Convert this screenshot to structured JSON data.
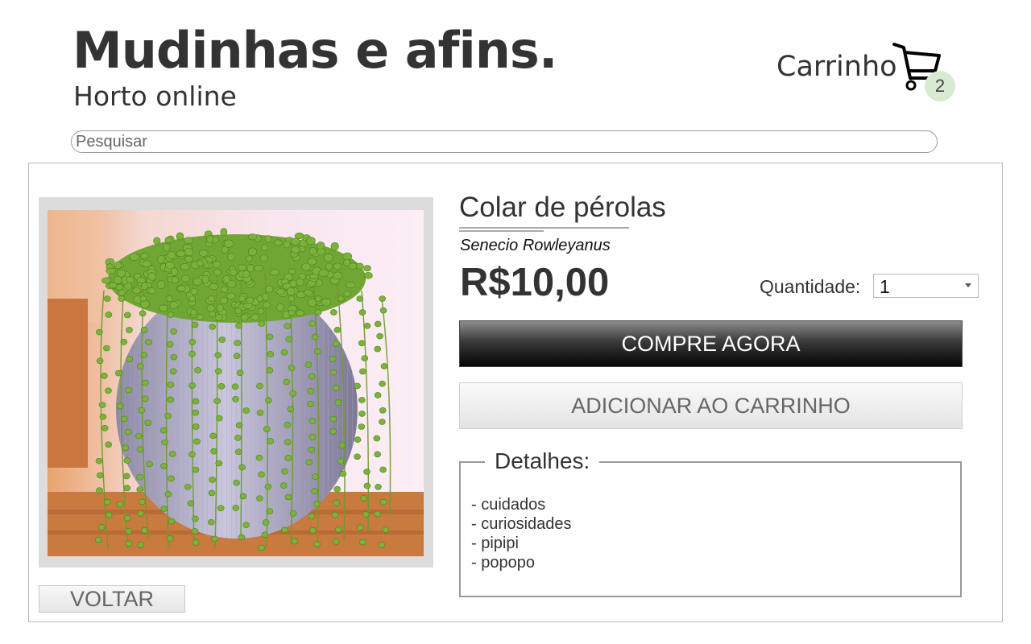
{
  "brand": {
    "title": "Mudinhas e afins.",
    "subtitle": "Horto online"
  },
  "cart": {
    "label": "Carrinho",
    "count": "2",
    "badge_color": "#d9ead3",
    "icon": "shopping-cart-icon"
  },
  "search": {
    "placeholder": "Pesquisar",
    "value": ""
  },
  "product": {
    "name": "Colar de pérolas",
    "scientific_name": "Senecio Rowleyanus",
    "price": "R$10,00",
    "image_alt": "Colar de pérolas"
  },
  "quantity": {
    "label": "Quantidade:",
    "selected": "1"
  },
  "actions": {
    "buy_now": "COMPRE AGORA",
    "add_to_cart": "ADICIONAR AO CARRINHO",
    "back": "VOLTAR"
  },
  "details": {
    "title": "Detalhes:",
    "items": [
      "- cuidados",
      "- curiosidades",
      "- pipipi",
      "- popopo"
    ]
  },
  "colors": {
    "text": "#333333",
    "buy_button": "#050505",
    "panel_border": "#bbbbbb"
  }
}
